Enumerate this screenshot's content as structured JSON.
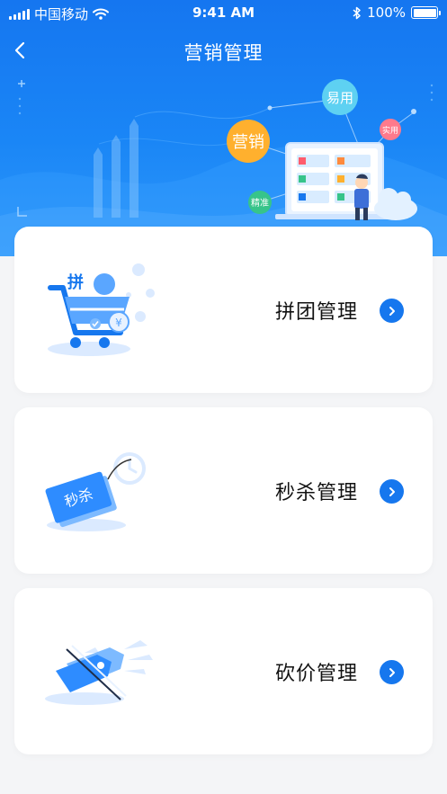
{
  "status_bar": {
    "carrier": "中国移动",
    "time": "9:41 AM",
    "battery": "100%",
    "battery_level": 1.0
  },
  "nav": {
    "title": "营销管理"
  },
  "banner": {
    "bubbles": {
      "marketing": "营销",
      "easy": "易用",
      "practical": "实用",
      "precise": "精准"
    }
  },
  "cards": [
    {
      "label": "拼团管理",
      "icon": "cart-icon",
      "badge": "拼"
    },
    {
      "label": "秒杀管理",
      "icon": "flash-sale-icon",
      "badge": "秒杀"
    },
    {
      "label": "砍价管理",
      "icon": "price-cut-icon"
    }
  ],
  "colors": {
    "primary": "#1677ee",
    "header": "#1a86f6",
    "background": "#f4f5f7",
    "card": "#ffffff"
  }
}
